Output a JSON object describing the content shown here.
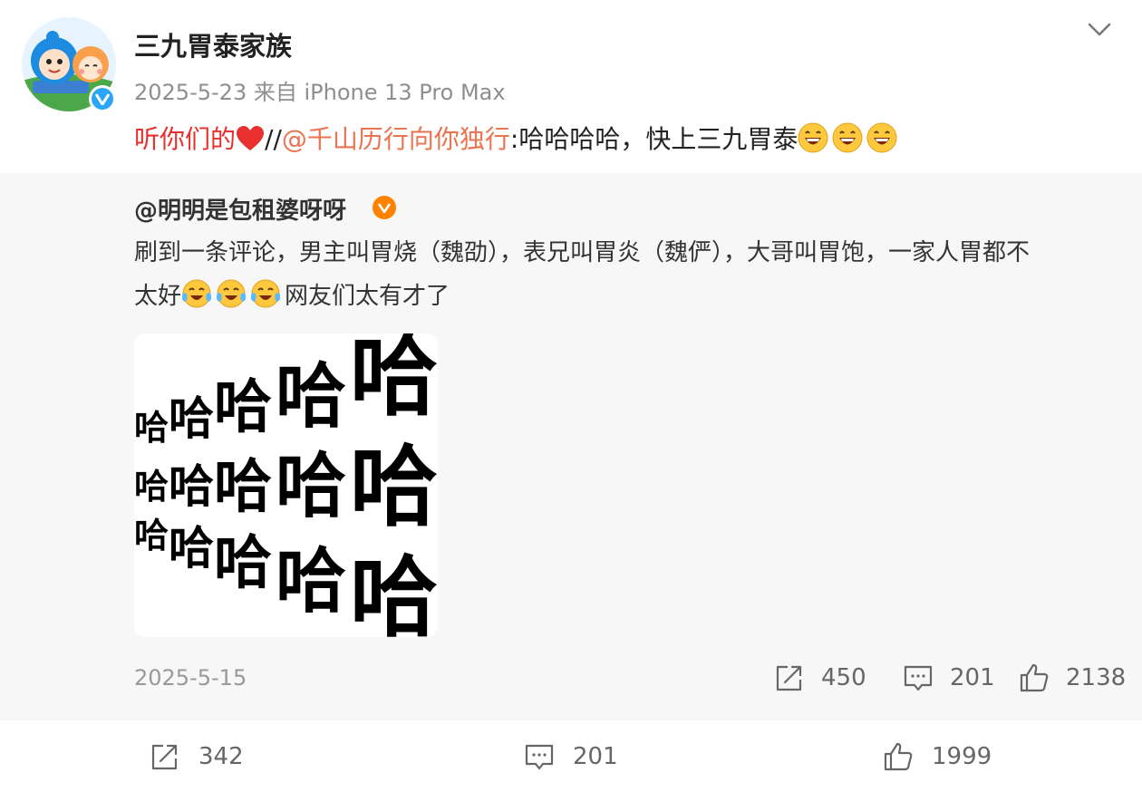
{
  "post": {
    "username": "三九胃泰家族",
    "meta": "2025-5-23 来自 iPhone 13 Pro Max",
    "text_prefix": "听你们的",
    "sep": "//",
    "mention": "@千山历行向你独行",
    "colon": ":",
    "text_body": "哈哈哈哈，快上三九胃泰",
    "emoji_icon": "laughing-face-icon"
  },
  "repost": {
    "author": "@明明是包租婆呀呀",
    "text_line1": "刷到一条评论，男主叫胃烧（魏劭），表兄叫胃炎（魏俨），大哥叫胃饱，一家人胃都不",
    "text_line2_prefix": "太好",
    "text_line2_suffix": "网友们太有才了",
    "emoji_icon": "laugh-cry-icon",
    "image_word": "哈",
    "date": "2025-5-15",
    "reposts": "450",
    "comments": "201",
    "likes": "2138"
  },
  "footer": {
    "reposts": "342",
    "comments": "201",
    "likes": "1999"
  },
  "colors": {
    "accent_orange": "#eb7350",
    "heart_red": "#e8312f",
    "verified_blue": "#2ba5f7",
    "badge_orange": "#ff8200"
  }
}
